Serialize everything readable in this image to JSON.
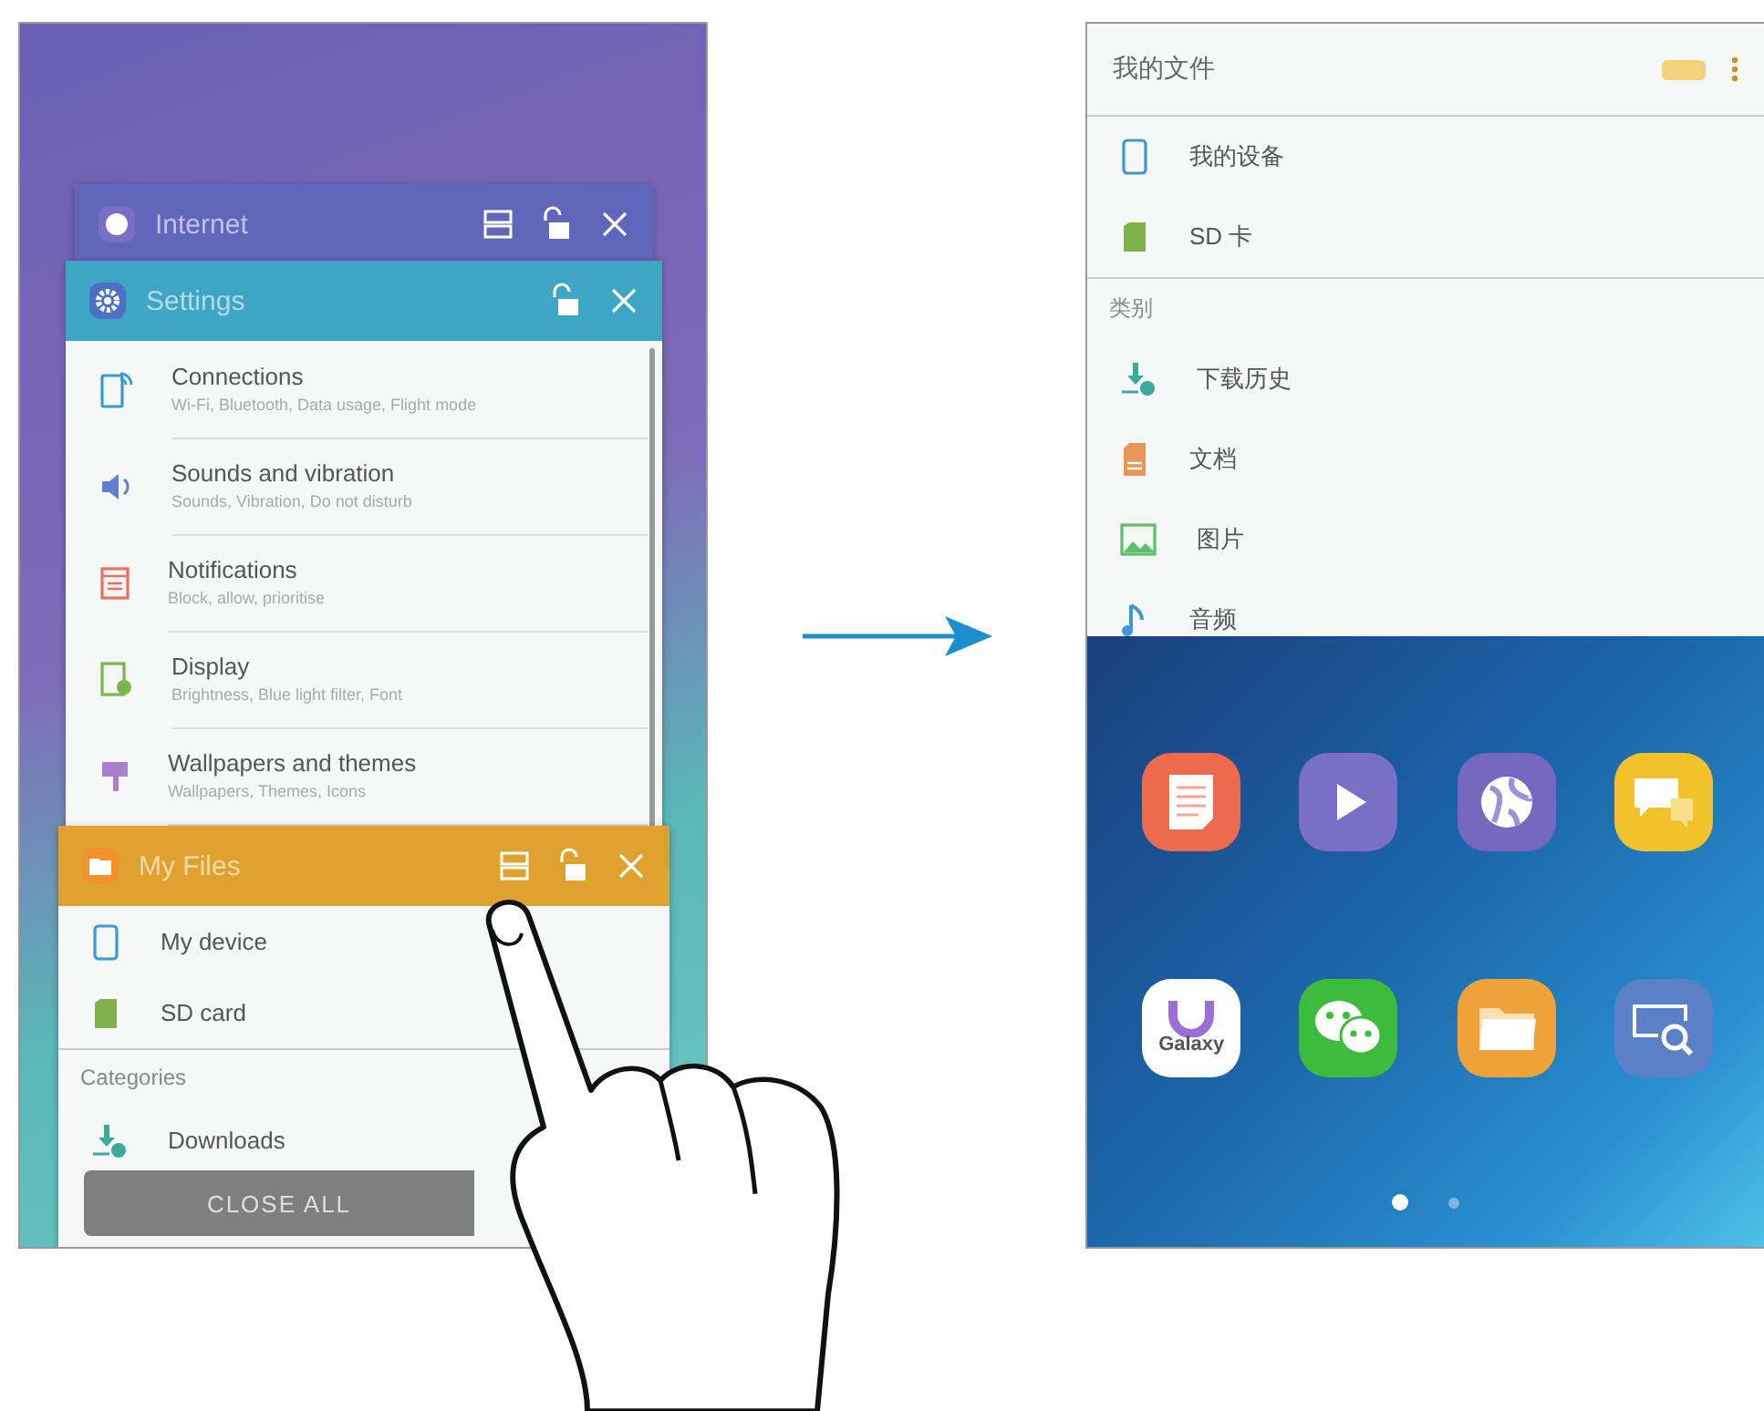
{
  "left_screen": {
    "internet_window": {
      "title": "Internet"
    },
    "settings_window": {
      "title": "Settings",
      "items": [
        {
          "kind": "connections",
          "title": "Connections",
          "subtitle": "Wi-Fi, Bluetooth, Data usage, Flight mode"
        },
        {
          "kind": "sounds",
          "title": "Sounds and vibration",
          "subtitle": "Sounds, Vibration, Do not disturb"
        },
        {
          "kind": "notifications",
          "title": "Notifications",
          "subtitle": "Block, allow, prioritise"
        },
        {
          "kind": "display",
          "title": "Display",
          "subtitle": "Brightness, Blue light filter, Font"
        },
        {
          "kind": "wallpapers",
          "title": "Wallpapers and themes",
          "subtitle": "Wallpapers, Themes, Icons"
        }
      ]
    },
    "files_window": {
      "title": "My Files",
      "storage": [
        {
          "kind": "device",
          "name": "My device"
        },
        {
          "kind": "sd",
          "name": "SD card"
        }
      ],
      "section": "Categories",
      "categories": [
        {
          "kind": "downloads",
          "name": "Downloads"
        }
      ]
    },
    "close_all_button": "CLOSE ALL"
  },
  "right_screen": {
    "file_list": {
      "title": "我的文件",
      "storage": [
        {
          "kind": "device",
          "name": "我的设备"
        },
        {
          "kind": "sd",
          "name": "SD 卡"
        }
      ],
      "section": "类别",
      "categories": [
        {
          "kind": "downloads",
          "name": "下载历史"
        },
        {
          "kind": "documents",
          "name": "文档"
        },
        {
          "kind": "images",
          "name": "图片"
        },
        {
          "kind": "audio",
          "name": "音频"
        }
      ]
    },
    "home_screen": {
      "apps": [
        {
          "kind": "notes"
        },
        {
          "kind": "video"
        },
        {
          "kind": "internet"
        },
        {
          "kind": "messages"
        },
        {
          "kind": "store",
          "icon_text": "Galaxy"
        },
        {
          "kind": "chat"
        },
        {
          "kind": "folder"
        },
        {
          "kind": "search"
        }
      ],
      "page_dots": [
        {
          "selected": true
        },
        {
          "selected": false
        }
      ]
    }
  }
}
